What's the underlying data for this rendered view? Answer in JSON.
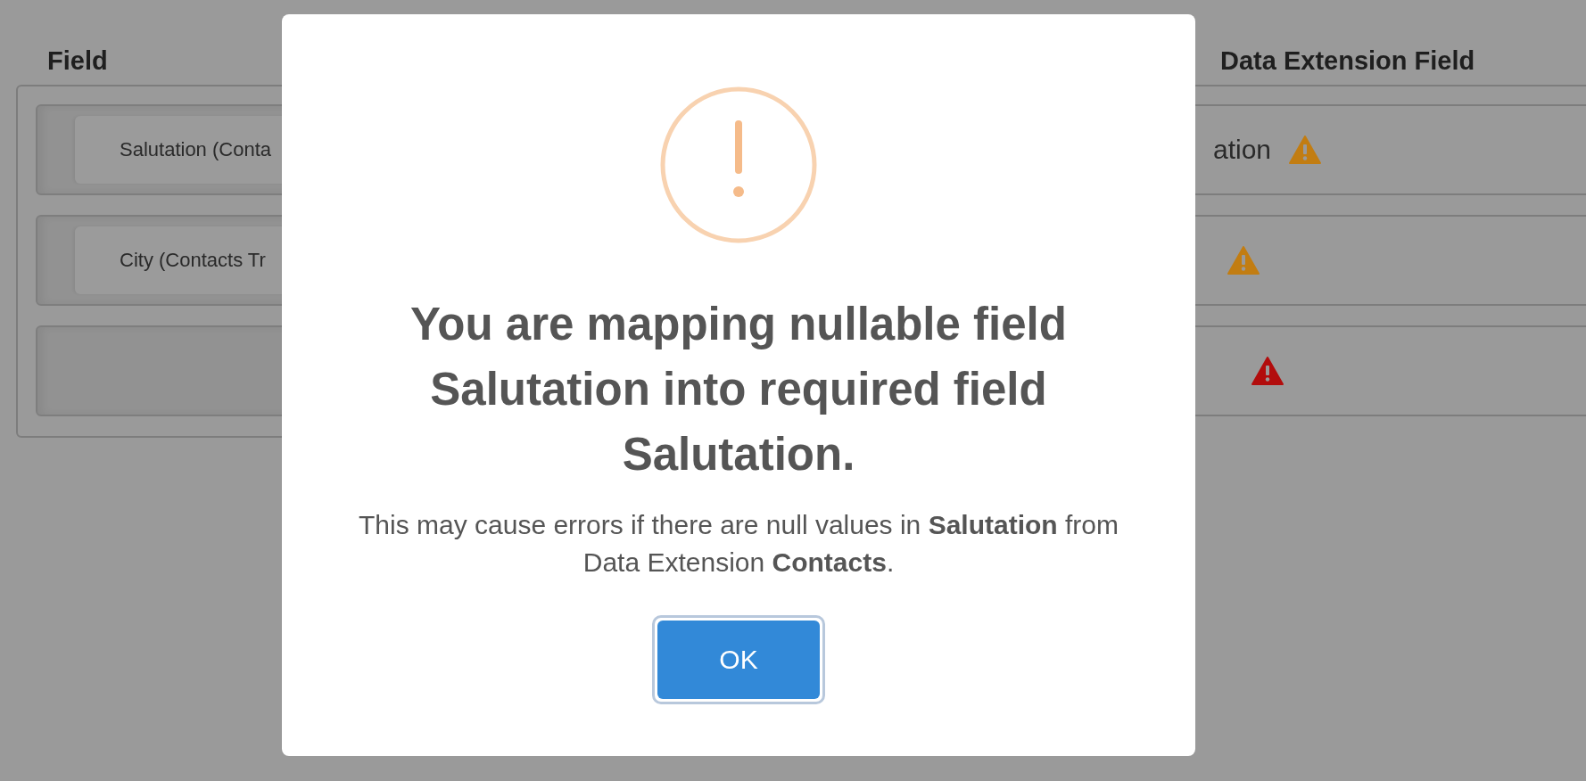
{
  "columns": [
    {
      "heading": "Field"
    },
    {
      "heading": "Data Extension Field"
    }
  ],
  "mappings": [
    {
      "source": "Salutation (Conta",
      "target": "ation",
      "color": "#c27d12"
    },
    {
      "source": "City (Contacts Tr",
      "color": "#c27d12"
    },
    {
      "color": "#b20d0d"
    }
  ],
  "dialog": {
    "title": "You are mapping nullable field Salutation into required field Salutation.",
    "message": "This may cause errors if there are null values in **Salutation** from Data Extension **Contacts**.",
    "button": "OK"
  }
}
